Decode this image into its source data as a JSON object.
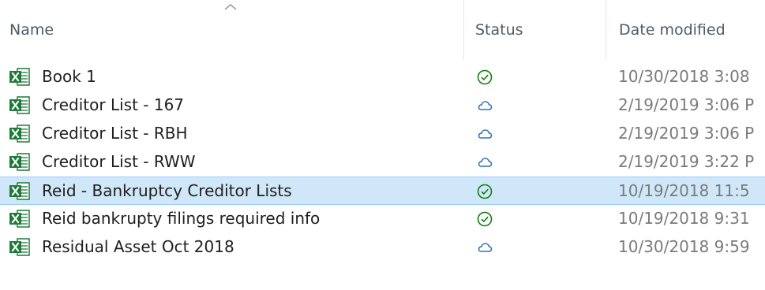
{
  "columns": {
    "name": "Name",
    "status": "Status",
    "date_modified": "Date modified"
  },
  "sort": {
    "icon": "sort-up-chevron-icon"
  },
  "colors": {
    "excel_green": "#1f7a3a",
    "synced_green": "#107c10",
    "cloud_blue": "#2f73b8",
    "selected_row": "#cfe7f8",
    "selected_border": "#9ccfff",
    "header_text": "#4f5b66",
    "date_text": "#7b7b7b"
  },
  "files": [
    {
      "name": "Book 1",
      "status_icon": "synced-check-icon",
      "date_modified": "10/30/2018 3:08",
      "selected": false
    },
    {
      "name": "Creditor List - 167",
      "status_icon": "cloud-icon",
      "date_modified": "2/19/2019 3:06 P",
      "selected": false
    },
    {
      "name": "Creditor List - RBH",
      "status_icon": "cloud-icon",
      "date_modified": "2/19/2019 3:06 P",
      "selected": false
    },
    {
      "name": "Creditor List - RWW",
      "status_icon": "cloud-icon",
      "date_modified": "2/19/2019 3:22 P",
      "selected": false
    },
    {
      "name": "Reid - Bankruptcy Creditor Lists",
      "status_icon": "synced-check-icon",
      "date_modified": "10/19/2018 11:5",
      "selected": true
    },
    {
      "name": "Reid bankrupty filings required info",
      "status_icon": "synced-check-icon",
      "date_modified": "10/19/2018 9:31",
      "selected": false
    },
    {
      "name": "Residual Asset Oct 2018",
      "status_icon": "cloud-icon",
      "date_modified": "10/30/2018 9:59",
      "selected": false
    }
  ]
}
